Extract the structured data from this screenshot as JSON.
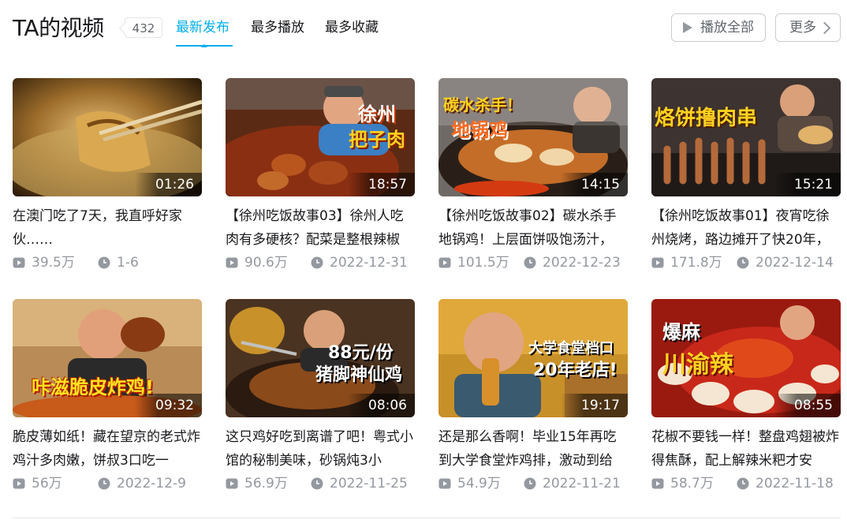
{
  "header": {
    "title": "TA的视频",
    "count": "432",
    "tabs": [
      {
        "label": "最新发布",
        "active": true
      },
      {
        "label": "最多播放",
        "active": false
      },
      {
        "label": "最多收藏",
        "active": false
      }
    ],
    "play_all_label": "播放全部",
    "more_label": "更多"
  },
  "colors": {
    "accent": "#00aeec",
    "text": "#18191c",
    "muted": "#9499a0"
  },
  "videos": [
    {
      "title": "在澳门吃了7天，我直呼好家伙……",
      "duration": "01:26",
      "views": "39.5万",
      "date": "1-6",
      "overlay": [
        "",
        ""
      ]
    },
    {
      "title": "【徐州吃饭故事03】徐州人吃肉有多硬核？配菜是整根辣椒",
      "duration": "18:57",
      "views": "90.6万",
      "date": "2022-12-31",
      "overlay": [
        "徐州",
        "把子肉"
      ]
    },
    {
      "title": "【徐州吃饭故事02】碳水杀手地锅鸡！上层面饼吸饱汤汁，",
      "duration": "14:15",
      "views": "101.5万",
      "date": "2022-12-23",
      "overlay": [
        "碳水杀手！",
        "地锅鸡"
      ]
    },
    {
      "title": "【徐州吃饭故事01】夜宵吃徐州烧烤，路边摊开了快20年，",
      "duration": "15:21",
      "views": "171.8万",
      "date": "2022-12-14",
      "overlay": [
        "烙饼撸肉串",
        ""
      ]
    },
    {
      "title": "脆皮薄如纸！藏在望京的老式炸鸡汁多肉嫩，饼叔3口吃一",
      "duration": "09:32",
      "views": "56万",
      "date": "2022-12-9",
      "overlay": [
        "咔滋脆皮炸鸡!",
        ""
      ]
    },
    {
      "title": "这只鸡好吃到离谱了吧！粤式小馆的秘制美味，砂锅炖3小",
      "duration": "08:06",
      "views": "56.9万",
      "date": "2022-11-25",
      "overlay": [
        "88元/份",
        "猪脚神仙鸡"
      ]
    },
    {
      "title": "还是那么香啊！毕业15年再吃到大学食堂炸鸡排，激动到给",
      "duration": "19:17",
      "views": "54.9万",
      "date": "2022-11-21",
      "overlay": [
        "大学食堂档口",
        "20年老店!"
      ]
    },
    {
      "title": "花椒不要钱一样！整盘鸡翅被炸得焦酥，配上解辣米粑才安",
      "duration": "08:55",
      "views": "58.7万",
      "date": "2022-11-18",
      "overlay": [
        "爆麻",
        "川渝辣"
      ]
    }
  ]
}
